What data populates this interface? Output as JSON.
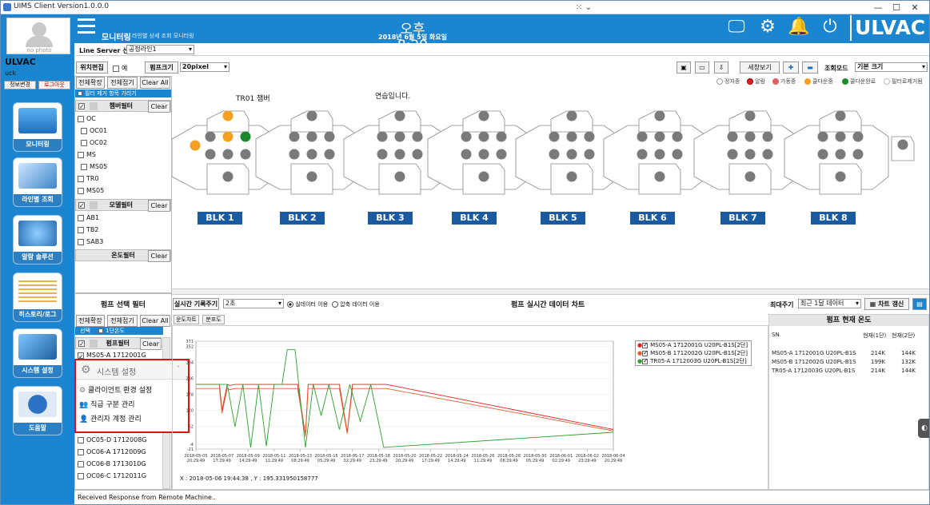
{
  "window": {
    "title": "UIMS Client Version1.0.0.0"
  },
  "user": {
    "no_photo": "no photo",
    "name": "ULVAC",
    "id": "uck",
    "info_btn": "정보변경",
    "logout_btn": "로그아웃"
  },
  "sidebar": {
    "items": [
      {
        "label": "모니터링",
        "icon": "monitor-icon"
      },
      {
        "label": "라인별 조회",
        "icon": "network-icon"
      },
      {
        "label": "알람 솔루션",
        "icon": "globe-icon"
      },
      {
        "label": "히스토리/로그",
        "icon": "report-icon"
      },
      {
        "label": "시스템 설정",
        "icon": "computers-icon"
      },
      {
        "label": "도움말",
        "icon": "help-icon"
      }
    ]
  },
  "header": {
    "title": "모니터링",
    "subtitle": "라인별 상세 조회 모니터링",
    "time": "오후 8:29",
    "date": "2018년 6월 5일 화요일",
    "logo": "ULVAC"
  },
  "line_server": {
    "label": "Line Server 선택",
    "value": "공정라인1"
  },
  "toolbar": {
    "pos_edit": "위치편집",
    "yes": "예",
    "pump_size": "펌프크기",
    "pump_size_value": "20pixel",
    "tile_view": "세창보기",
    "view_mode": "조회모드",
    "view_mode_value": "기본 크기"
  },
  "filter_panel": {
    "expand_all": "전체확장",
    "collapse_all": "전체접기",
    "clear_all": "Clear All",
    "remove_filter": "필터 제거 항목 가리기",
    "chamber_filter": "챔버필터",
    "clear": "Clear",
    "chamber_items": [
      "OC",
      "OC01",
      "OC02",
      "MS",
      "MS05",
      "TR0",
      "MS05"
    ],
    "model_filter": "모델필터",
    "model_items": [
      "AB1",
      "TB2",
      "SAB3"
    ],
    "temp_filter": "온도필터"
  },
  "pump_select": {
    "title": "펌프 선택 필터",
    "expand_all": "전체확장",
    "collapse_all": "전체접기",
    "clear_all": "Clear All",
    "chip_select": "선택",
    "chip_temp": "1단온도",
    "pump_filter": "펌프필터",
    "clear": "Clear",
    "first_item": "MS05-A 1712001G",
    "items": [
      "OC05-D 1712008G",
      "OC06-A 1712009G",
      "OC06-B 1713010G",
      "OC06-C 1712011G"
    ]
  },
  "system_menu": {
    "title": "시스템 설정",
    "items": [
      {
        "label": "클라이언트 환경 설정",
        "icon": "gear-icon"
      },
      {
        "label": "직급 구분 관리",
        "icon": "people-icon"
      },
      {
        "label": "관리자 계정 관리",
        "icon": "admin-icon"
      }
    ]
  },
  "legend": [
    {
      "label": "정지중",
      "color": "#ffffff"
    },
    {
      "label": "알람",
      "color": "#e02020"
    },
    {
      "label": "가동중",
      "color": "#e06060"
    },
    {
      "label": "쿨다운중",
      "color": "#f5a020"
    },
    {
      "label": "쿨다운완료",
      "color": "#1a8a2a"
    },
    {
      "label": "필터로제거됨",
      "color": "#ffffff"
    }
  ],
  "blocks": [
    "BLK 1",
    "BLK 2",
    "BLK 3",
    "BLK 4",
    "BLK 5",
    "BLK 6",
    "BLK 7",
    "BLK 8"
  ],
  "annotations": {
    "chamber": "TR01 챔버",
    "note": "연습입니다."
  },
  "chart_controls": {
    "record_period": "실시간 기록주기",
    "period_value": "2초",
    "realtime": "실데이터 이용",
    "compressed": "압축 데이터 이용",
    "title": "펌프 실시간 데이터 차트",
    "tab1": "운도차트",
    "tab2": "분포도",
    "max_period": "최대주기",
    "max_period_value": "최근 1달 데이터",
    "refresh": "차트 갱신"
  },
  "chart_data": {
    "type": "line",
    "title": "",
    "xlabel": "",
    "ylabel": "",
    "ylim": [
      -21,
      371
    ],
    "y_ticks": [
      "371",
      "352",
      "294",
      "236",
      "178",
      "120",
      "62",
      "-4",
      "-21"
    ],
    "x_ticks": [
      [
        "2018-05-05",
        "20:29:49"
      ],
      [
        "2018-05-07",
        "17:29:49"
      ],
      [
        "2018-05-09",
        "14:29:49"
      ],
      [
        "2018-05-11",
        "11:29:49"
      ],
      [
        "2018-05-13",
        "08:29:49"
      ],
      [
        "2018-05-15",
        "05:29:49"
      ],
      [
        "2018-05-17",
        "02:29:49"
      ],
      [
        "2018-05-18",
        "23:29:49"
      ],
      [
        "2018-05-20",
        "20:29:49"
      ],
      [
        "2018-05-22",
        "17:29:49"
      ],
      [
        "2018-05-24",
        "14:29:49"
      ],
      [
        "2018-05-26",
        "11:29:49"
      ],
      [
        "2018-05-28",
        "08:29:49"
      ],
      [
        "2018-05-30",
        "05:29:49"
      ],
      [
        "2018-06-01",
        "02:29:49"
      ],
      [
        "2018-06-02",
        "23:29:49"
      ],
      [
        "2018-06-04",
        "20:29:49"
      ]
    ],
    "series": [
      {
        "name": "MS05-A 1712001G U20PL-B1S[2단]",
        "color": "#e02020",
        "x": [
          0,
          0.9,
          1,
          1.2,
          1.3,
          1.5,
          3.9,
          4.2,
          4.3,
          4.5,
          5,
          5.5,
          5.8,
          6,
          6.3,
          6.8,
          7.2,
          7.3,
          16
        ],
        "y": [
          214,
          214,
          120,
          214,
          210,
          214,
          214,
          30,
          214,
          214,
          214,
          214,
          40,
          214,
          214,
          214,
          214,
          214,
          50
        ]
      },
      {
        "name": "MS05-B 1712002G U20PL-B1S[2단]",
        "color": "#e06030",
        "x": [
          0,
          0.9,
          1,
          1.2,
          1.3,
          1.5,
          3.9,
          4.2,
          4.3,
          4.5,
          5,
          5.5,
          5.8,
          6,
          6.3,
          6.8,
          7.2,
          7.3,
          16
        ],
        "y": [
          199,
          199,
          110,
          199,
          195,
          199,
          199,
          25,
          199,
          199,
          199,
          199,
          35,
          199,
          199,
          199,
          199,
          199,
          45
        ]
      },
      {
        "name": "TR05-A 1712003G U20PL-B1S[2단]",
        "color": "#2ca02c",
        "x": [
          0,
          1.2,
          1.5,
          1.8,
          2.1,
          2.4,
          2.7,
          3,
          3.3,
          3.5,
          3.8,
          4.2,
          4.5,
          4.8,
          5.1,
          5.5,
          5.9,
          6.3,
          6.7,
          7.2,
          16
        ],
        "y": [
          214,
          214,
          60,
          214,
          -15,
          214,
          -10,
          214,
          214,
          340,
          340,
          -15,
          214,
          100,
          214,
          50,
          214,
          80,
          214,
          -15,
          40
        ]
      }
    ]
  },
  "chart_legend_box": [
    "MS05-A 1712001G U20PL-B1S[2단]",
    "MS05-B 1712002G U20PL-B1S[2단]",
    "TR05-A 1712003G U20PL-B1S[2단]"
  ],
  "cursor_readout": "X : 2018-05-06 19:44:38 , Y : 195.331950158777",
  "temp_table": {
    "title": "펌프 현재 온도",
    "headers": [
      "SN",
      "현재(1단)",
      "현재(2단)"
    ],
    "rows": [
      [
        "MS05-A 1712001G U20PL-B1S",
        "214K",
        "144K"
      ],
      [
        "MS05-B 1712002G U20PL-B1S",
        "199K",
        "132K"
      ],
      [
        "TR05-A 1712003G U20PL-B1S",
        "214K",
        "144K"
      ]
    ]
  },
  "status": "Received Response from Remote Machine.."
}
